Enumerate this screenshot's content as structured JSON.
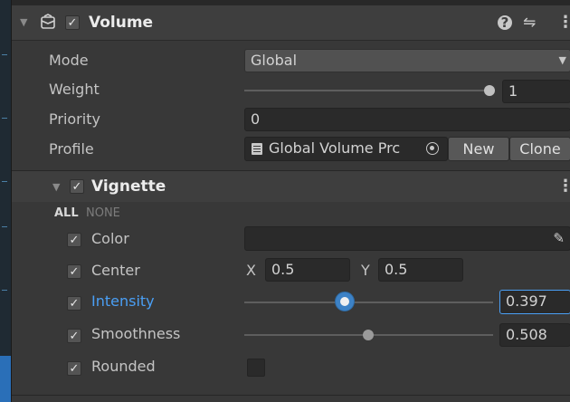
{
  "component": {
    "title": "Volume",
    "enabled_check": "✓",
    "help_icon": "?",
    "preset_icon": "⇋",
    "menu_icon": "⋮"
  },
  "properties": {
    "mode": {
      "label": "Mode",
      "value": "Global",
      "arrow": "▼"
    },
    "weight": {
      "label": "Weight",
      "value": "1",
      "slider_fraction": 1.0
    },
    "priority": {
      "label": "Priority",
      "value": "0"
    },
    "profile": {
      "label": "Profile",
      "value": "Global Volume Prc",
      "new_label": "New",
      "clone_label": "Clone"
    }
  },
  "vignette": {
    "title": "Vignette",
    "enabled_check": "✓",
    "menu_icon": "⋮",
    "all_label": "ALL",
    "none_label": "NONE",
    "color": {
      "label": "Color",
      "check": "✓",
      "picker_icon": "✎"
    },
    "center": {
      "label": "Center",
      "check": "✓",
      "x_label": "X",
      "x_value": "0.5",
      "y_label": "Y",
      "y_value": "0.5"
    },
    "intensity": {
      "label": "Intensity",
      "check": "✓",
      "value": "0.397",
      "slider_fraction": 0.397
    },
    "smoothness": {
      "label": "Smoothness",
      "check": "✓",
      "value": "0.508",
      "slider_fraction": 0.508
    },
    "rounded": {
      "label": "Rounded",
      "check": "✓"
    }
  },
  "colors": {
    "accent": "#4a9ff5",
    "panel_bg": "#383838",
    "field_bg": "#2a2a2a"
  }
}
